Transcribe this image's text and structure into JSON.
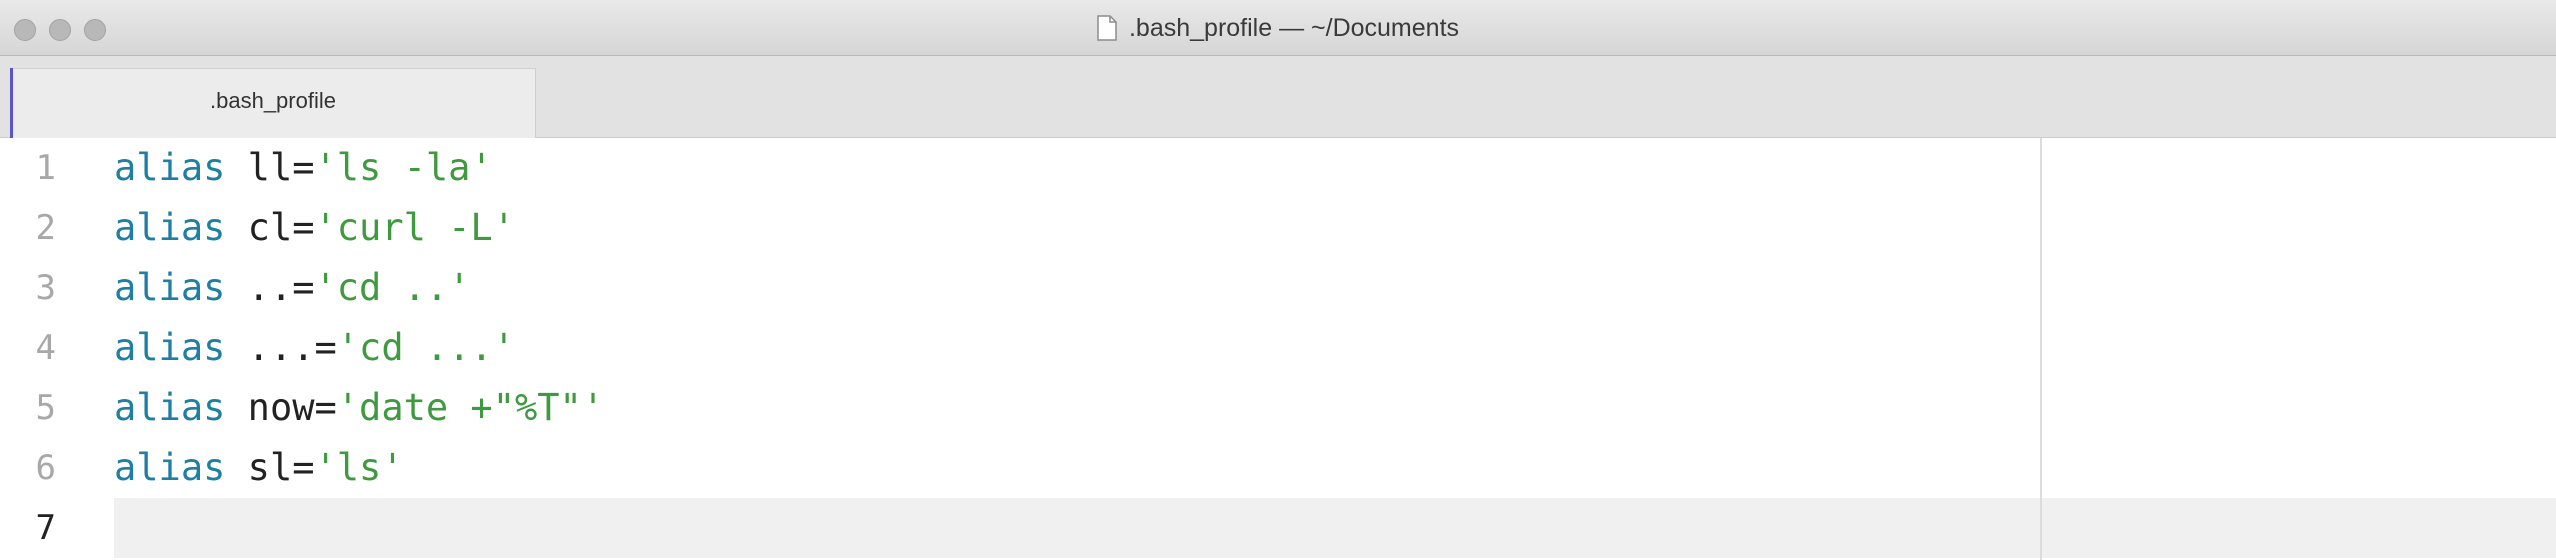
{
  "window": {
    "title": ".bash_profile — ~/Documents",
    "title_icon": "document-icon"
  },
  "tabs": [
    {
      "label": ".bash_profile",
      "active": true
    }
  ],
  "editor": {
    "active_line": 7,
    "lines": [
      {
        "number": "1",
        "keyword": "alias",
        "name": " ll=",
        "value": "'ls -la'"
      },
      {
        "number": "2",
        "keyword": "alias",
        "name": " cl=",
        "value": "'curl -L'"
      },
      {
        "number": "3",
        "keyword": "alias",
        "name": " ..=",
        "value": "'cd ..'"
      },
      {
        "number": "4",
        "keyword": "alias",
        "name": " ...=",
        "value": "'cd ...'"
      },
      {
        "number": "5",
        "keyword": "alias",
        "name": " now=",
        "value": "'date +\"%T\"'"
      },
      {
        "number": "6",
        "keyword": "alias",
        "name": " sl=",
        "value": "'ls'"
      },
      {
        "number": "7",
        "keyword": "",
        "name": "",
        "value": ""
      }
    ]
  },
  "colors": {
    "keyword": "#1f7fa3",
    "string": "#3f9a3f",
    "tab_accent": "#5b53c8"
  }
}
